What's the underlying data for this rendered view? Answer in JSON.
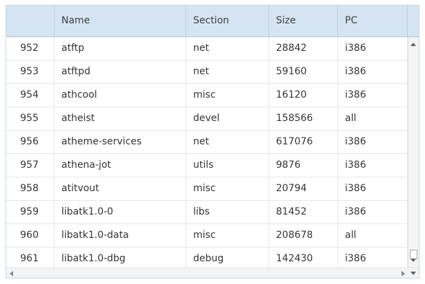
{
  "header": {
    "columns": [
      "",
      "Name",
      "Section",
      "Size",
      "PC"
    ]
  },
  "rows": [
    {
      "id": "952",
      "name": "atftp",
      "section": "net",
      "size": "28842",
      "pc": "i386"
    },
    {
      "id": "953",
      "name": "atftpd",
      "section": "net",
      "size": "59160",
      "pc": "i386"
    },
    {
      "id": "954",
      "name": "athcool",
      "section": "misc",
      "size": "16120",
      "pc": "i386"
    },
    {
      "id": "955",
      "name": "atheist",
      "section": "devel",
      "size": "158566",
      "pc": "all"
    },
    {
      "id": "956",
      "name": "atheme-services",
      "section": "net",
      "size": "617076",
      "pc": "i386"
    },
    {
      "id": "957",
      "name": "athena-jot",
      "section": "utils",
      "size": "9876",
      "pc": "i386"
    },
    {
      "id": "958",
      "name": "atitvout",
      "section": "misc",
      "size": "20794",
      "pc": "i386"
    },
    {
      "id": "959",
      "name": "libatk1.0-0",
      "section": "libs",
      "size": "81452",
      "pc": "i386"
    },
    {
      "id": "960",
      "name": "libatk1.0-data",
      "section": "misc",
      "size": "208678",
      "pc": "all"
    },
    {
      "id": "961",
      "name": "libatk1.0-dbg",
      "section": "debug",
      "size": "142430",
      "pc": "i386"
    }
  ],
  "icons": {
    "scroll_up": "chevron-up-icon",
    "scroll_down": "chevron-down-icon",
    "scroll_left": "chevron-left-icon",
    "scroll_right": "chevron-right-icon"
  },
  "colors": {
    "header_bg": "#d5e4f3",
    "border": "#c9d6e3",
    "row_divider": "#e6e6e6",
    "text": "#333333"
  }
}
